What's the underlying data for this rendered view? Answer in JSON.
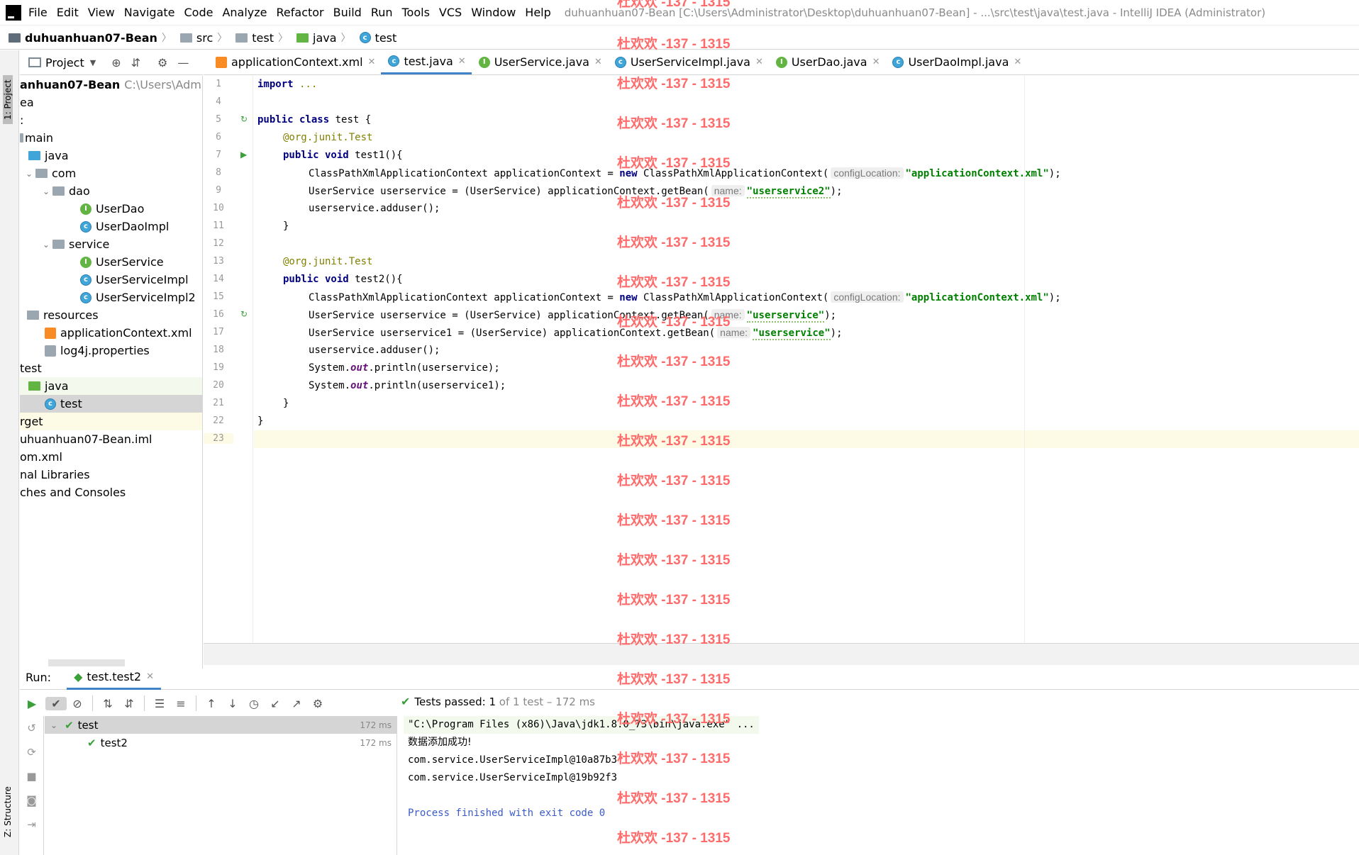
{
  "menubar": {
    "items": [
      "File",
      "Edit",
      "View",
      "Navigate",
      "Code",
      "Analyze",
      "Refactor",
      "Build",
      "Run",
      "Tools",
      "VCS",
      "Window",
      "Help"
    ],
    "window_title": "duhuanhuan07-Bean [C:\\Users\\Administrator\\Desktop\\duhuanhuan07-Bean] - ...\\src\\test\\java\\test.java - IntelliJ IDEA (Administrator)"
  },
  "breadcrumb": [
    "duhuanhuan07-Bean",
    "src",
    "test",
    "java",
    "test"
  ],
  "left_strip": {
    "project_tab": "1: Project",
    "structure_tab": "Z: Structure"
  },
  "project_panel": {
    "title": "Project"
  },
  "tree": [
    {
      "label": "anhuan07-Bean",
      "extra": "C:\\Users\\Administ",
      "bold": true
    },
    {
      "label": "ea"
    },
    {
      "label": ":"
    },
    {
      "label": "main"
    },
    {
      "label": "java"
    },
    {
      "label": "com"
    },
    {
      "label": "dao"
    },
    {
      "label": "UserDao"
    },
    {
      "label": "UserDaoImpl"
    },
    {
      "label": "service"
    },
    {
      "label": "UserService"
    },
    {
      "label": "UserServiceImpl"
    },
    {
      "label": "UserServiceImpl2"
    },
    {
      "label": "resources"
    },
    {
      "label": "applicationContext.xml"
    },
    {
      "label": "log4j.properties"
    },
    {
      "label": "test"
    },
    {
      "label": "java"
    },
    {
      "label": "test"
    },
    {
      "label": "rget"
    },
    {
      "label": "uhuanhuan07-Bean.iml"
    },
    {
      "label": "om.xml"
    },
    {
      "label": "nal Libraries"
    },
    {
      "label": "ches and Consoles"
    }
  ],
  "tabs": [
    "applicationContext.xml",
    "test.java",
    "UserService.java",
    "UserServiceImpl.java",
    "UserDao.java",
    "UserDaoImpl.java"
  ],
  "line_numbers": [
    "1",
    "4",
    "5",
    "6",
    "7",
    "8",
    "9",
    "10",
    "11",
    "12",
    "13",
    "14",
    "15",
    "16",
    "17",
    "18",
    "19",
    "20",
    "21",
    "22",
    "23"
  ],
  "code": {
    "l1_kw": "import",
    "l1_rest": " ...",
    "l5_kw": "public class",
    "l5_rest": " test {",
    "l6_ann": "@org.junit.",
    "l6_test": "Test",
    "l7_kw": "public void",
    "l7_rest": " test1(){",
    "l8_a": "ClassPathXmlApplicationContext applicationContext = ",
    "l8_new": "new",
    "l8_b": " ClassPathXmlApplicationContext(",
    "l8_hint": "configLocation:",
    "l8_str": "\"applicationContext.xml\"",
    "l8_end": ");",
    "l9_a": "UserService userservice = (UserService) applicationContext.getBean(",
    "l9_hint": "name:",
    "l9_str": "\"userservice2\"",
    "l9_end": ");",
    "l10": "userservice.adduser();",
    "l11": "}",
    "l13_ann": "@org.junit.",
    "l13_test": "Test",
    "l14_kw": "public void",
    "l14_rest": " test2(){",
    "l15_a": "ClassPathXmlApplicationContext applicationContext = ",
    "l15_new": "new",
    "l15_b": " ClassPathXmlApplicationContext(",
    "l15_hint": "configLocation:",
    "l15_str": "\"applicationContext.xml\"",
    "l15_end": ");",
    "l16_a": "UserService userservice = (UserService) applicationContext.getBean(",
    "l16_hint": "name:",
    "l16_str": "\"userservice\"",
    "l16_end": ");",
    "l17_a": "UserService userservice1 = (UserService) applicationContext.getBean(",
    "l17_hint": "name:",
    "l17_str": "\"userservice\"",
    "l17_end": ");",
    "l18": "userservice.adduser();",
    "l19_a": "System.",
    "l19_out": "out",
    "l19_b": ".println(userservice);",
    "l20_a": "System.",
    "l20_out": "out",
    "l20_b": ".println(userservice1);",
    "l21": "}",
    "l22": "}"
  },
  "run": {
    "label": "Run:",
    "tab": "test.test2",
    "status_prefix": "Tests passed:",
    "status_count": "1",
    "status_suffix": "of 1 test – 172 ms",
    "tree": [
      {
        "label": "test",
        "time": "172 ms"
      },
      {
        "label": "test2",
        "time": "172 ms"
      }
    ],
    "console": [
      "\"C:\\Program Files (x86)\\Java\\jdk1.8.0_73\\bin\\java.exe\" ...",
      "数据添加成功!",
      "com.service.UserServiceImpl@10a87b3",
      "com.service.UserServiceImpl@19b92f3",
      "",
      "Process finished with exit code 0"
    ]
  },
  "watermark": "杜欢欢 -137 - 1315",
  "colors": {
    "accent": "#4083c9",
    "keyword": "#000080",
    "string": "#008000",
    "watermark": "#ff6b6b",
    "pass": "#3aa03a"
  }
}
